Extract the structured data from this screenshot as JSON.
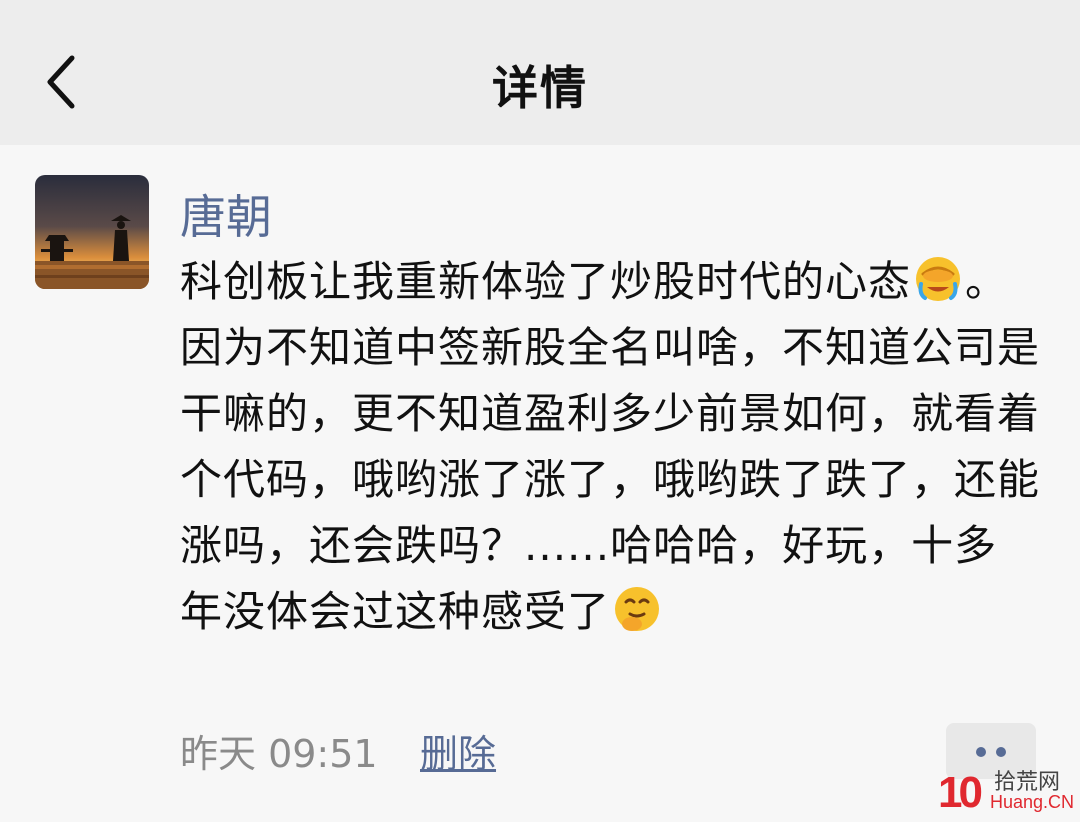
{
  "header": {
    "title": "详情",
    "back_icon": "chevron-left-icon"
  },
  "post": {
    "author": "唐朝",
    "avatar_icon": "sunset-silhouette-avatar",
    "text_part1": "科创板让我重新体验了炒股时代的心态",
    "text_part2": "。因为不知道中签新股全名叫啥，不知道公司是干嘛的，更不知道盈利多少前景如何，就看着个代码，哦哟涨了涨了，哦哟跌了跌了，还能涨吗，还会跌吗？......哈哈哈，好玩，十多年没体会过这种感受了",
    "emoji1": "facepalm-emoji",
    "emoji2": "chuckle-emoji",
    "timestamp": "昨天 09:51",
    "delete_label": "删除",
    "more_icon": "more-dots-icon"
  },
  "watermark": {
    "logo": "10",
    "name": "拾荒网",
    "domain": "Huang.CN"
  },
  "colors": {
    "header_bg": "#ededed",
    "page_bg": "#f7f7f7",
    "link": "#576b95",
    "text": "#111111",
    "meta": "#8a8a8a",
    "watermark_red": "#e0282f"
  }
}
